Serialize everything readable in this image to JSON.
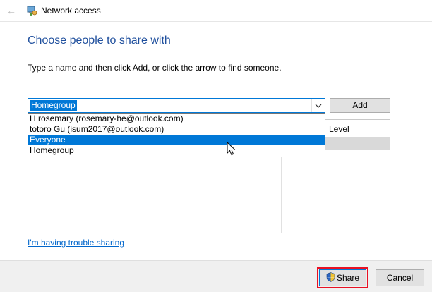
{
  "window": {
    "title": "Network access",
    "back_icon": "back-arrow-icon",
    "app_icon": "network-share-icon"
  },
  "heading": "Choose people to share with",
  "instructions": "Type a name and then click Add, or click the arrow to find someone.",
  "combo": {
    "value": "Homegroup",
    "arrow_icon": "chevron-down-icon"
  },
  "add_button": "Add",
  "dropdown_options": [
    "H rosemary (rosemary-he@outlook.com)",
    "totoro Gu (isum2017@outlook.com)",
    "Everyone",
    "Homegroup"
  ],
  "highlighted_option": "Everyone",
  "table": {
    "level_header": "Level"
  },
  "trouble_link": "I'm having trouble sharing",
  "share_button": {
    "label": "Share",
    "icon": "uac-shield-icon"
  },
  "cancel_button": "Cancel",
  "colors": {
    "accent": "#0078d7",
    "heading": "#1f4f9d",
    "highlight_box": "#e81123"
  }
}
